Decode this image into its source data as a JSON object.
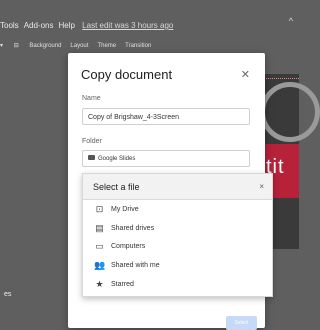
{
  "menubar": {
    "items": [
      "Tools",
      "Add-ons",
      "Help"
    ],
    "last_edit": "Last edit was 3 hours ago"
  },
  "toolbar": {
    "items": [
      "Background",
      "Layout",
      "Theme",
      "Transition"
    ]
  },
  "slide": {
    "partial_text": "tit"
  },
  "left_fragment": "es",
  "dialog": {
    "title": "Copy document",
    "name_label": "Name",
    "name_value": "Copy of Brigshaw_4-3Screen",
    "folder_label": "Folder",
    "folder_value": "Google Slides",
    "select_button": "Select"
  },
  "picker": {
    "title": "Select a file",
    "items": [
      {
        "label": "My Drive",
        "icon": "my-drive-icon"
      },
      {
        "label": "Shared drives",
        "icon": "shared-drives-icon"
      },
      {
        "label": "Computers",
        "icon": "computers-icon"
      },
      {
        "label": "Shared with me",
        "icon": "shared-with-me-icon"
      },
      {
        "label": "Starred",
        "icon": "star-icon"
      }
    ]
  }
}
